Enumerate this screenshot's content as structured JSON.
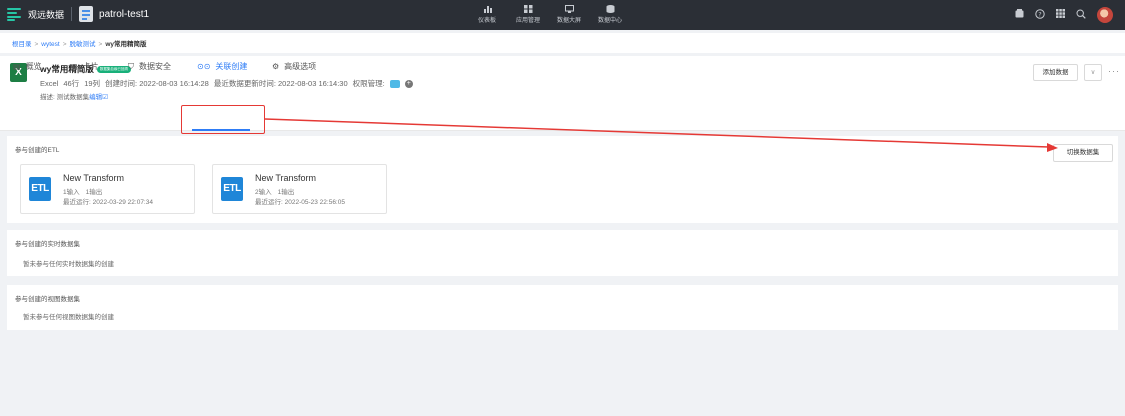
{
  "topbar": {
    "brand": "观远数据",
    "project": "patrol-test1",
    "nav": [
      {
        "label": "仪表板",
        "icon": "bar-chart-icon",
        "color": "#c8ccd2"
      },
      {
        "label": "应用管理",
        "icon": "apps-icon",
        "color": "#c8ccd2"
      },
      {
        "label": "数据大屏",
        "icon": "screen-icon",
        "color": "#c8ccd2"
      },
      {
        "label": "数据中心",
        "icon": "database-icon",
        "color": "#c8ccd2"
      }
    ],
    "right_icons": [
      "notification-icon",
      "help-icon",
      "grid-icon",
      "search-icon",
      "avatar"
    ]
  },
  "breadcrumb": {
    "items": [
      "根目录",
      "wytest",
      "脱敏测试"
    ],
    "current": "wy常用精简版",
    "separator": ">"
  },
  "dataset": {
    "title": "wy常用精简版",
    "badge": "数据集血缘已回溯",
    "type": "Excel",
    "rows": "46行",
    "cols": "19列",
    "created": "创建时间: 2022-08-03 16:14:28",
    "updated": "最近数据更新时间: 2022-08-03 16:14:30",
    "permission_label": "权限管理:",
    "description_label": "描述: 测试数据集",
    "edit_link": "编辑☑"
  },
  "actions": {
    "add_data": "添加数据",
    "dropdown": "∨",
    "more": "···"
  },
  "tabs": [
    {
      "label": "概览",
      "icon": "overview-icon",
      "glyph": "▤"
    },
    {
      "label": "卡片",
      "icon": "card-icon",
      "glyph": "▨"
    },
    {
      "label": "数据安全",
      "icon": "shield-icon",
      "glyph": "⛉"
    },
    {
      "label": "关联创建",
      "icon": "link-icon",
      "glyph": "⊙⊙",
      "active": true
    },
    {
      "label": "高级选项",
      "icon": "settings-icon",
      "glyph": "⚙"
    }
  ],
  "etl_section": {
    "title": "参与创建的ETL",
    "switch_button": "切换数据集",
    "cards": [
      {
        "badge": "ETL",
        "name": "New Transform",
        "inputs": "1输入",
        "outputs": "1输出",
        "last_run": "最近运行: 2022-03-29 22:07:34"
      },
      {
        "badge": "ETL",
        "name": "New Transform",
        "inputs": "2输入",
        "outputs": "1输出",
        "last_run": "最近运行: 2022-05-23 22:56:05"
      }
    ]
  },
  "realtime_section": {
    "title": "参与创建的实时数据集",
    "empty": "暂未参与任何实时数据集的创建"
  },
  "view_section": {
    "title": "参与创建的视图数据集",
    "empty": "暂未参与任何视图数据集的创建"
  },
  "colors": {
    "accent": "#2e7cf6",
    "topbar": "#2b2f36",
    "annotation": "#e53935",
    "excel": "#1d7e44",
    "etl": "#1f86d8"
  }
}
